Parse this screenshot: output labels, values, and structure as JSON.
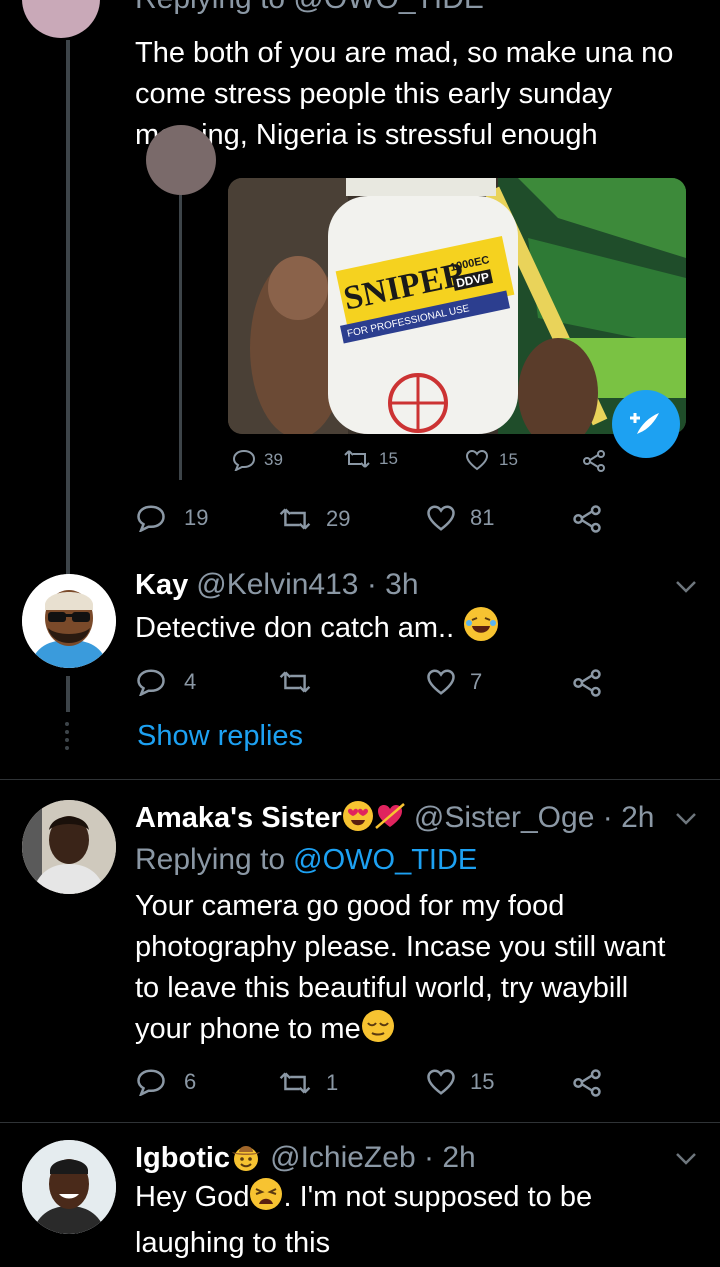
{
  "tweet_top": {
    "replying_to_partial": "Replying to @OWO_TIDE",
    "text_lines": [
      "The both of you are mad, so make una no",
      "come stress people this early sunday",
      "morning, Nigeria is stressful enough"
    ],
    "quoted": {
      "bottle_label": "SNIPER",
      "bottle_sub": "1000EC",
      "bottle_sub2": "DDVP",
      "bottle_line": "FOR PROFESSIONAL USE",
      "reply_count": "39",
      "retweet_count": "15",
      "like_count": "15"
    },
    "reply_count": "19",
    "retweet_count": "29",
    "like_count": "81"
  },
  "tweet_kay": {
    "name": "Kay",
    "handle": "@Kelvin413",
    "time": "3h",
    "text": "Detective don catch am..",
    "reply_count": "4",
    "retweet_count": "",
    "like_count": "7",
    "show_replies": "Show replies"
  },
  "tweet_amaka": {
    "name": "Amaka's Sister",
    "handle": "@Sister_Oge",
    "time": "2h",
    "replying_label": "Replying to",
    "replying_handle": "@OWO_TIDE",
    "text_lines": [
      "Your camera go good for my food",
      "photography please. Incase you still want",
      "to leave this beautiful world, try waybill",
      "your phone to me"
    ],
    "reply_count": "6",
    "retweet_count": "1",
    "like_count": "15"
  },
  "tweet_igbotic": {
    "name": "Igbotic",
    "handle": "@IchieZeb",
    "time": "2h",
    "text_lines": [
      "Hey God",
      ". I'm not supposed to be",
      "laughing to this"
    ]
  },
  "colors": {
    "accent": "#1da1f2",
    "muted": "#8b98a5",
    "background": "#000000"
  }
}
